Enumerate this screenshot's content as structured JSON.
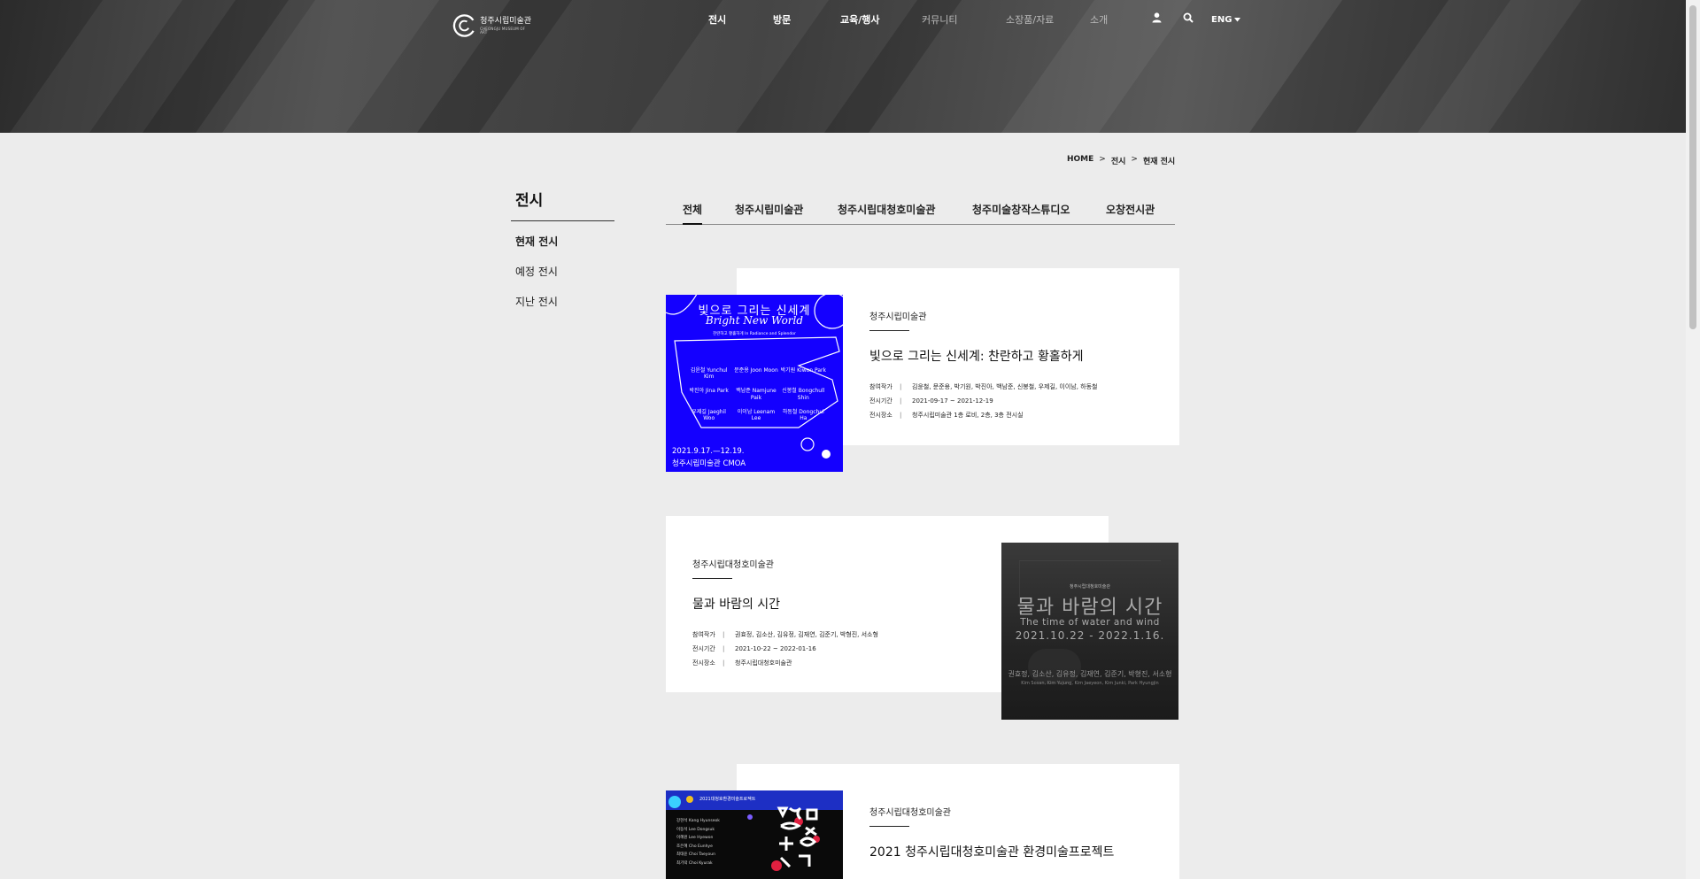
{
  "header": {
    "logo_ko": "청주시립미술관",
    "logo_en": "CHEONGJU MUSEUM OF ART",
    "nav": [
      "전시",
      "방문",
      "교육/행사",
      "커뮤니티",
      "소장품/자료",
      "소개"
    ],
    "lang": "ENG"
  },
  "breadcrumb": [
    "HOME",
    "전시",
    "현재 전시"
  ],
  "breadcrumb_sep": ">",
  "side": {
    "title": "전시",
    "items": [
      "현재 전시",
      "예정 전시",
      "지난 전시"
    ]
  },
  "tabs": [
    "전체",
    "청주시립미술관",
    "청주시립대청호미술관",
    "청주미술창작스튜디오",
    "오창전시관"
  ],
  "field_labels": {
    "artists": "참여작가",
    "period": "전시기간",
    "place": "전시장소"
  },
  "exhibitions": [
    {
      "venue": "청주시립미술관",
      "title": "빛으로 그리는 신세계: 찬란하고 황홀하게",
      "artists": "김윤철, 문준용, 박기원, 박진아, 백남준, 신봉철, 우제길, 이이남, 하동철",
      "period": "2021-09-17 ~ 2021-12-19",
      "place": "청주시립미술관 1층 로비, 2층, 3층 전시실",
      "poster": {
        "title_ko": "빛으로 그리는 신세계",
        "title_en": "Bright New World",
        "subtitle": "찬란하고 황홀하게 In Radiance and Splendor",
        "names": [
          "김윤철 Yunchul Kim",
          "문준용 Joon Moon",
          "박기원 Kiwon Park",
          "박진아 Jina Park",
          "백남준 Namjune Paik",
          "신봉철 Bongchull Shin",
          "우제길 Jaeghil Woo",
          "이이남 Leenam Lee",
          "하동철 Dongchul Ha"
        ],
        "date": "2021.9.17.—12.19.",
        "org": "청주시립미술관 CMOA"
      }
    },
    {
      "venue": "청주시립대청호미술관",
      "title": "물과 바람의 시간",
      "artists": "권효정, 김소산, 김유정, 김재연, 김준기, 박형진, 서소형",
      "period": "2021-10-22 ~ 2022-01-16",
      "place": "청주시립대청호미술관",
      "poster": {
        "org": "청주시립대청호미술관",
        "title_ko": "물과 바람의 시간",
        "title_en": "The time of water and wind",
        "date": "2021.10.22 - 2022.1.16.",
        "names": "권효정, 김소산, 김유정, 김재연, 김준기, 박형진, 서소형",
        "names_en": "Kim Sosan, Kim Yujung, Kim Jaeyeon, Kim Junki, Park Hyungjin"
      }
    },
    {
      "venue": "청주시립대청호미술관",
      "title": "2021 청주시립대청호미술관 환경미술프로젝트",
      "poster": {
        "banner": "2021대청호환경미술프로젝트",
        "list": [
          "강현석 Kang Hyunseok",
          "이동석 Lee Dongsuk",
          "이혜원 Lee Hyewon",
          "조은혜 Cho Eunhye",
          "최태윤 Choi Taeyoun",
          "최기락 Choi Kyurak"
        ]
      }
    }
  ],
  "colors": {
    "poster1_bg": "#1400ff",
    "poster2_bg": "#2a2a2a",
    "poster3_bg": "#0a0a0a",
    "hero": "#3a3a3a"
  }
}
